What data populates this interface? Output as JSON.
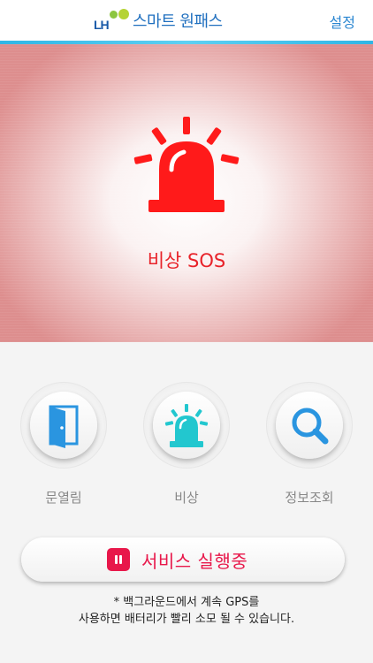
{
  "header": {
    "logo_mark": "LH",
    "logo_text": "스마트 원패스",
    "settings_label": "설정"
  },
  "sos": {
    "label": "비상 SOS",
    "icon": "siren-icon"
  },
  "actions": [
    {
      "label": "문열림",
      "icon": "door-icon"
    },
    {
      "label": "비상",
      "icon": "siren-icon"
    },
    {
      "label": "정보조회",
      "icon": "search-icon"
    }
  ],
  "service": {
    "label": "서비스 실행중",
    "icon": "pause-icon"
  },
  "notice": {
    "line1": "* 백그라운드에서 계속 GPS를",
    "line2": "사용하면 배터리가 빨리 소모 될 수 있습니다."
  },
  "colors": {
    "accent_red": "#e8232a",
    "service_pink": "#e8174a",
    "header_blue": "#1f6fbf",
    "icon_blue": "#2a95e0",
    "icon_cyan": "#22c7cf"
  }
}
